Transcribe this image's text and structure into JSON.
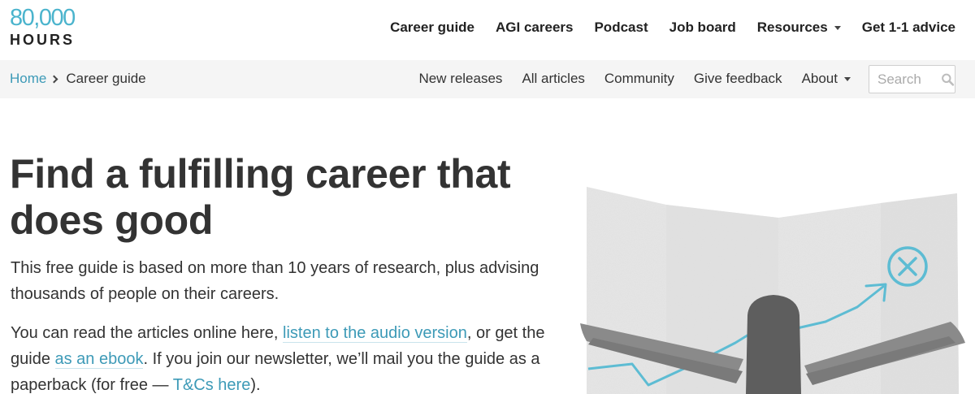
{
  "logo": {
    "number": "80,000",
    "word": "HOURS"
  },
  "main_nav": {
    "career_guide": "Career guide",
    "agi_careers": "AGI careers",
    "podcast": "Podcast",
    "job_board": "Job board",
    "resources": "Resources",
    "advice": "Get 1-1 advice"
  },
  "breadcrumb": {
    "home": "Home",
    "current": "Career guide"
  },
  "sub_nav": {
    "new_releases": "New releases",
    "all_articles": "All articles",
    "community": "Community",
    "give_feedback": "Give feedback",
    "about": "About"
  },
  "search": {
    "placeholder": "Search"
  },
  "hero": {
    "title": "Find a fulfilling career that does good",
    "intro": "This free guide is based on more than 10 years of research, plus advising thousands of people on their careers.",
    "read_prefix": "You can read the articles online here, ",
    "audio_link": "listen to the audio version",
    "read_mid": ", or get the guide ",
    "ebook_link": "as an ebook",
    "read_mid2": ". If you join our newsletter, we’ll mail you the guide as a paperback (for free — ",
    "tcs_link": "T&Cs here",
    "read_suffix": ")."
  },
  "colors": {
    "accent": "#4bb4cd",
    "link": "#3d9ab7",
    "text": "#333333",
    "subbar_bg": "#f5f5f5"
  }
}
